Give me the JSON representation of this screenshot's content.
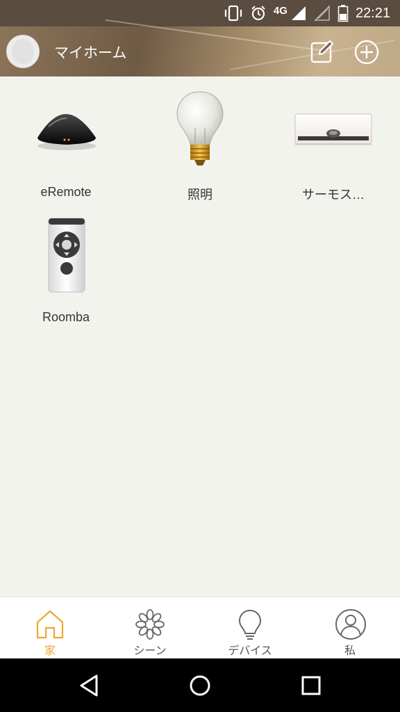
{
  "status_bar": {
    "network": "4G",
    "time": "22:21",
    "icons": [
      "vibrate-icon",
      "alarm-icon",
      "signal-icon",
      "signal-empty-icon",
      "battery-icon"
    ]
  },
  "header": {
    "title": "マイホーム",
    "icons": [
      "avatar",
      "edit-icon",
      "add-icon"
    ]
  },
  "devices": [
    {
      "label": "eRemote",
      "icon": "eremote-device-icon"
    },
    {
      "label": "照明",
      "icon": "light-bulb-icon"
    },
    {
      "label": "サーモス…",
      "icon": "air-conditioner-icon"
    },
    {
      "label": "Roomba",
      "icon": "remote-control-icon"
    }
  ],
  "bottom_nav": {
    "items": [
      {
        "label": "家",
        "icon": "home-icon",
        "active": true
      },
      {
        "label": "シーン",
        "icon": "scene-flower-icon",
        "active": false
      },
      {
        "label": "デバイス",
        "icon": "bulb-outline-icon",
        "active": false
      },
      {
        "label": "私",
        "icon": "user-icon",
        "active": false
      }
    ]
  },
  "colors": {
    "accent": "#f0a531",
    "background": "#f3f3ee",
    "nav_background": "#ffffff",
    "system_bar": "#000000"
  }
}
